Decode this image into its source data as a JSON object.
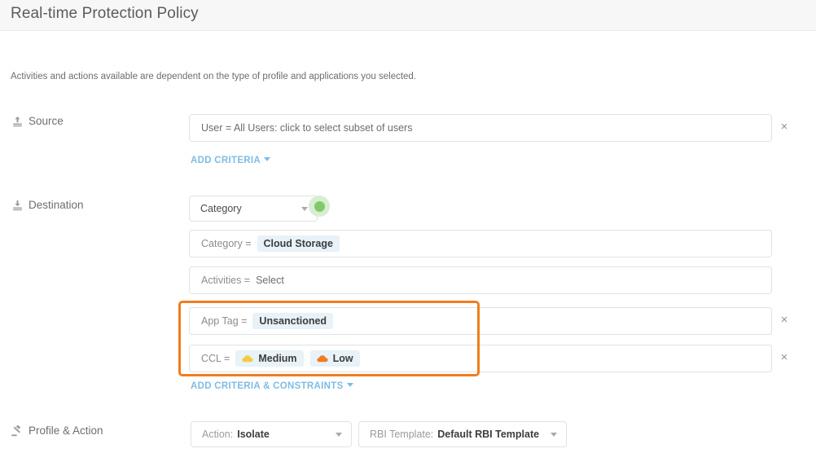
{
  "header": {
    "title": "Real-time Protection Policy"
  },
  "helper_note": "Activities and actions available are dependent on the type of profile and applications you selected.",
  "sections": {
    "source": {
      "label": "Source",
      "icon": "upload-icon",
      "field_value": "User = All Users: click to select subset of users",
      "remove_label": "×",
      "add_link": "ADD CRITERIA"
    },
    "destination": {
      "label": "Destination",
      "icon": "download-icon",
      "type_select": {
        "value": "Category",
        "status": "active"
      },
      "criteria": [
        {
          "key": "Category =",
          "chips": [
            {
              "label": "Cloud Storage",
              "icon": null
            }
          ],
          "plain": "",
          "removable": false,
          "highlighted": false
        },
        {
          "key": "Activities =",
          "chips": [],
          "plain": "Select",
          "removable": false,
          "highlighted": false
        },
        {
          "key": "App Tag =",
          "chips": [
            {
              "label": "Unsanctioned",
              "icon": null
            }
          ],
          "plain": "",
          "removable": true,
          "highlighted": true
        },
        {
          "key": "CCL =",
          "chips": [
            {
              "label": "Medium",
              "icon": "cloud-icon",
              "icon_color": "#f5cb3f"
            },
            {
              "label": "Low",
              "icon": "cloud-icon",
              "icon_color": "#f07d1e"
            }
          ],
          "plain": "",
          "removable": true,
          "highlighted": true
        }
      ],
      "add_link": "ADD CRITERIA & CONSTRAINTS",
      "remove_label": "×"
    },
    "profile_action": {
      "label": "Profile & Action",
      "icon": "gavel-icon",
      "action_select": {
        "label": "Action:",
        "value": "Isolate"
      },
      "rbi_select": {
        "label": "RBI Template:",
        "value": "Default RBI Template"
      }
    }
  },
  "colors": {
    "highlight_border": "#f07d1e",
    "link": "#7fbce4",
    "chip_bg": "#e8f2f8",
    "status_dot": "#82c96a",
    "header_bg": "#f7f7f7"
  }
}
